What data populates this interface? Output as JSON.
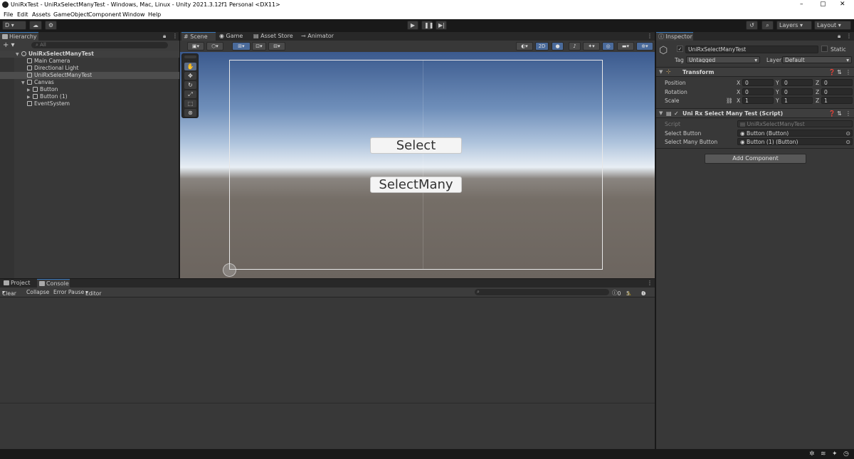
{
  "titlebar": {
    "title": "UniRxTest - UniRxSelectManyTest - Windows, Mac, Linux - Unity 2021.3.12f1 Personal <DX11>",
    "minimize": "–",
    "maximize": "▢",
    "close": "✕"
  },
  "menu": [
    "File",
    "Edit",
    "Assets",
    "GameObject",
    "Component",
    "Window",
    "Help"
  ],
  "toolbar": {
    "account": "D ▾",
    "layers": "Layers",
    "layout": "Layout"
  },
  "hierarchy": {
    "tab": "Hierarchy",
    "search_placeholder": "All",
    "add": "+ ▾",
    "scene": "UniRxSelectManyTest",
    "items": [
      "Main Camera",
      "Directional Light",
      "UniRxSelectManyTest",
      "Canvas",
      "Button",
      "Button (1)",
      "EventSystem"
    ]
  },
  "scene": {
    "tabs": [
      "Scene",
      "Game",
      "Asset Store",
      "Animator"
    ],
    "mode_2d": "2D",
    "button_select": "Select",
    "button_selectmany": "SelectMany"
  },
  "console": {
    "tabs": [
      "Project",
      "Console"
    ],
    "clear": "Clear",
    "collapse": "Collapse",
    "error_pause": "Error Pause",
    "editor": "Editor",
    "counts": {
      "log": "0",
      "warn": "5",
      "error": "0"
    }
  },
  "inspector": {
    "tab": "Inspector",
    "object_name": "UniRxSelectManyTest",
    "static": "Static",
    "tag_label": "Tag",
    "tag": "Untagged",
    "layer_label": "Layer",
    "layer": "Default",
    "transform": {
      "title": "Transform",
      "position_label": "Position",
      "rotation_label": "Rotation",
      "scale_label": "Scale",
      "position": [
        "0",
        "0",
        "0"
      ],
      "rotation": [
        "0",
        "0",
        "0"
      ],
      "scale": [
        "1",
        "1",
        "1"
      ],
      "axis": [
        "X",
        "Y",
        "Z"
      ]
    },
    "script": {
      "title": "Uni Rx Select Many Test (Script)",
      "script_label": "Script",
      "script_value": "UniRxSelectManyTest",
      "select_label": "Select Button",
      "select_value": "Button (Button)",
      "selectmany_label": "Select Many Button",
      "selectmany_value": "Button (1) (Button)"
    },
    "add_component": "Add Component"
  }
}
